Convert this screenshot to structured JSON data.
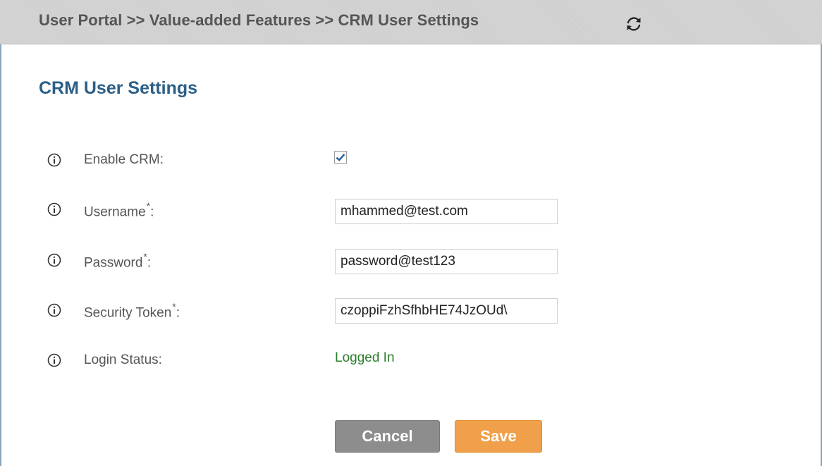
{
  "header": {
    "breadcrumb": "User Portal >> Value-added Features >> CRM User Settings",
    "refresh_icon": "refresh-icon"
  },
  "page": {
    "title": "CRM User Settings"
  },
  "form": {
    "info_icon": "info-circle-icon",
    "required_marker": "*",
    "enable_crm": {
      "label": "Enable CRM:",
      "checked": true
    },
    "username": {
      "label": "Username",
      "suffix": ":",
      "value": "mhammed@test.com"
    },
    "password": {
      "label": "Password",
      "suffix": ":",
      "value": "password@test123"
    },
    "security_token": {
      "label": "Security Token",
      "suffix": ":",
      "value": "czoppiFzhSfhbHE74JzOUd\\"
    },
    "login_status": {
      "label": "Login Status:",
      "value": "Logged In"
    }
  },
  "actions": {
    "cancel_label": "Cancel",
    "save_label": "Save"
  },
  "colors": {
    "title": "#2b5f87",
    "label": "#555555",
    "status_ok": "#2c7d2c",
    "cancel_button": "#8d8d8d",
    "save_button": "#f0a04a",
    "checkmark": "#1f5f9a"
  }
}
